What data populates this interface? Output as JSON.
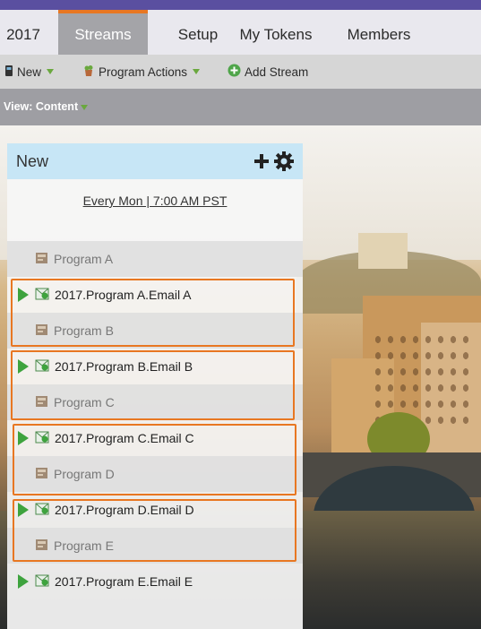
{
  "tabs": [
    {
      "label": "2017"
    },
    {
      "label": "Streams",
      "active": true
    },
    {
      "label": "Setup"
    },
    {
      "label": "My Tokens"
    },
    {
      "label": "Members"
    }
  ],
  "toolbar": {
    "new_label": "New",
    "program_actions_label": "Program Actions",
    "add_stream_label": "Add Stream"
  },
  "view": {
    "label": "View: Content"
  },
  "stream_panel": {
    "title": "New",
    "schedule": "Every Mon | 7:00 AM PST",
    "rows": [
      {
        "type": "program",
        "label": "Program A"
      },
      {
        "type": "email",
        "label": "2017.Program A.Email A"
      },
      {
        "type": "program",
        "label": "Program B"
      },
      {
        "type": "email",
        "label": "2017.Program B.Email B"
      },
      {
        "type": "program",
        "label": "Program C"
      },
      {
        "type": "email",
        "label": "2017.Program C.Email C"
      },
      {
        "type": "program",
        "label": "Program D"
      },
      {
        "type": "email",
        "label": "2017.Program D.Email D"
      },
      {
        "type": "program",
        "label": "Program E"
      },
      {
        "type": "email",
        "label": "2017.Program E.Email E"
      }
    ]
  },
  "colors": {
    "accent_orange": "#e87722",
    "header_purple": "#5a4fa0",
    "play_green": "#3ea33e",
    "panel_header_blue": "#c7e6f6"
  }
}
